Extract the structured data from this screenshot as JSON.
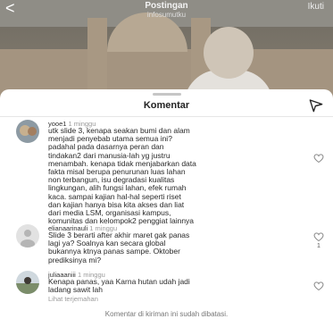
{
  "header": {
    "back_glyph": "<",
    "title": "Postingan",
    "subtitle": "infosumutku",
    "follow_label": "Ikuti"
  },
  "sheet": {
    "title": "Komentar"
  },
  "comments": [
    {
      "username": "yooe1",
      "time": "1 minggu",
      "lines": [
        "utk slide 3, kenapa seakan bumi dan alam",
        "menjadi penyebab utama semua ini?",
        "padahal pada dasarnya peran dan",
        "tindakan2 dari manusia-lah yg justru",
        "menambah. kenapa tidak menjabarkan data",
        "fakta misal berupa penurunan luas lahan",
        "non terbangun, isu degradasi kualitas",
        "lingkungan, alih fungsi lahan, efek rumah",
        "kaca. sampai kajian hal-hal seperti riset",
        "dan kajian hanya bisa kita akses dan liat",
        "dari media LSM, organisasi kampus,",
        "komunitas dan kelompok2 penggiat lainnya"
      ],
      "likes": ""
    },
    {
      "username": "elianaarinauli",
      "time": "1 minggu",
      "lines": [
        "Slide 3 berarti after akhir maret gak panas",
        "lagi ya? Soalnya kan secara global",
        "bukannya ktnya panas sampe. Oktober",
        "prediksinya mi?"
      ],
      "likes": "1"
    },
    {
      "username": "juliaaaniii",
      "time": "1 minggu",
      "lines": [
        "Kenapa panas, yaa Karna hutan udah jadi",
        "ladang sawit lah"
      ],
      "translate_label": "Lihat terjemahan",
      "likes": ""
    }
  ],
  "footer": {
    "text": "Komentar di kiriman ini sudah dibatasi."
  }
}
